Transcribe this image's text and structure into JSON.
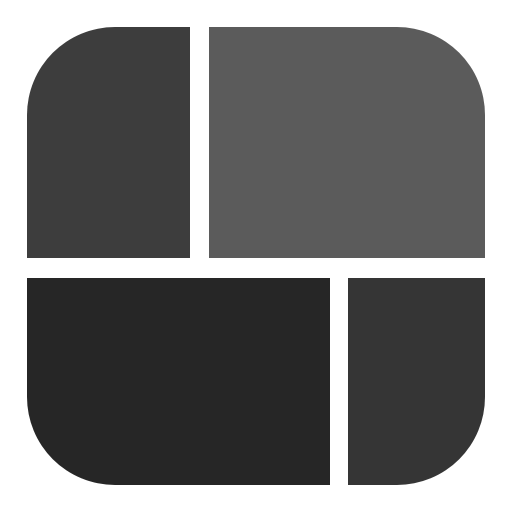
{
  "icon": {
    "name": "layout-grid-icon",
    "background_color": "#ffffff",
    "tiles": [
      {
        "name": "tile-top-left",
        "color": "#3d3d3d"
      },
      {
        "name": "tile-top-right",
        "color": "#5b5b5b"
      },
      {
        "name": "tile-bottom-left",
        "color": "#262626"
      },
      {
        "name": "tile-bottom-right",
        "color": "#353535"
      }
    ]
  }
}
